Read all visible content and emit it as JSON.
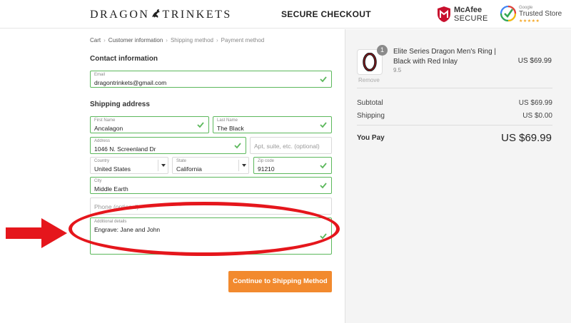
{
  "header": {
    "logo_left": "DRAGON",
    "logo_right": "TRINKETS",
    "title": "SECURE CHECKOUT",
    "mcafee_name": "McAfee",
    "mcafee_secure": "SECURE",
    "trusted_google": "Google",
    "trusted_name": "Trusted Store",
    "trusted_stars": "★★★★★"
  },
  "breadcrumb": [
    {
      "label": "Cart"
    },
    {
      "label": "Customer information"
    },
    {
      "label": "Shipping method"
    },
    {
      "label": "Payment method"
    }
  ],
  "contact": {
    "title": "Contact information",
    "email_label": "Email",
    "email_value": "dragontrinkets@gmail.com"
  },
  "shipping": {
    "title": "Shipping address",
    "first_name_label": "First Name",
    "first_name_value": "Ancalagon",
    "last_name_label": "Last Name",
    "last_name_value": "The Black",
    "address_label": "Address",
    "address_value": "1046 N. Screenland Dr",
    "apt_placeholder": "Apt, suite, etc. (optional)",
    "country_label": "Country",
    "country_value": "United States",
    "state_label": "State",
    "state_value": "California",
    "zip_label": "Zip code",
    "zip_value": "91210",
    "city_label": "City",
    "city_value": "Middle Earth",
    "phone_placeholder": "Phone (optional)",
    "details_label": "Additional details",
    "details_value": "Engrave: Jane and John"
  },
  "continue_label": "Continue to Shipping Method",
  "order": {
    "product_name": "Elite Series Dragon Men's Ring | Black with Red Inlay",
    "variant": "9.5",
    "quantity": "1",
    "remove_label": "Remove",
    "price": "US $69.99",
    "subtotal_label": "Subtotal",
    "subtotal_value": "US $69.99",
    "shipping_label": "Shipping",
    "shipping_value": "US $0.00",
    "total_label": "You Pay",
    "total_value": "US $69.99"
  },
  "colors": {
    "valid_border": "#5cb85c",
    "button": "#f28a2e",
    "annotation": "#e5161c",
    "panel_bg": "#f4f4f4"
  }
}
